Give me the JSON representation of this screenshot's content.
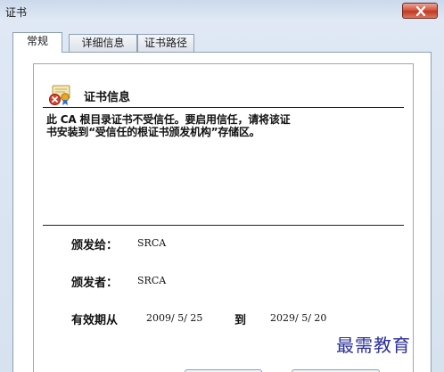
{
  "window": {
    "title": "证书"
  },
  "tabs": [
    {
      "label": "常规",
      "active": true
    },
    {
      "label": "详细信息",
      "active": false
    },
    {
      "label": "证书路径",
      "active": false
    }
  ],
  "certificate": {
    "heading": "证书信息",
    "warning_line1": "此 CA 根目录证书不受信任。要启用信任，请将该证",
    "warning_line2": "书安装到“受信任的根证书颁发机构”存储区。",
    "issued_to_label": "颁发给：",
    "issued_to_value": "SRCA",
    "issued_by_label": "颁发者：",
    "issued_by_value": "SRCA",
    "valid_from_label": "有效期从",
    "valid_from_value": "2009/ 5/ 25",
    "valid_to_label": "到",
    "valid_to_value": "2029/ 5/ 20"
  },
  "watermark": {
    "text": "最需教育"
  },
  "colors": {
    "close_button": "#c2381f",
    "watermark": "#2a2f9a",
    "window_frame": "#d7e2ef"
  },
  "icons": {
    "certificate": "certificate-untrusted-icon",
    "close": "close-icon"
  }
}
